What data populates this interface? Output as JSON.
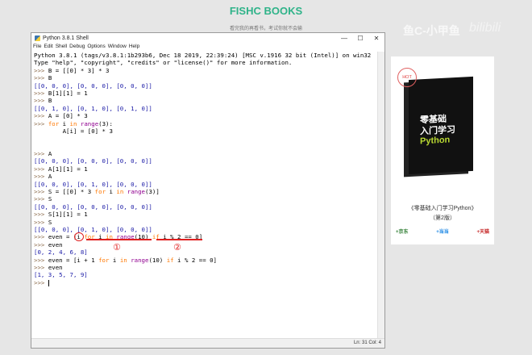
{
  "site": {
    "brand": "FISHC BOOKS",
    "slogan": "看完我的再看书，考试你就不会输",
    "watermark": "鱼C-小甲鱼",
    "watermark2": "bilibili"
  },
  "window": {
    "title": "Python 3.8.1 Shell",
    "controls": [
      "—",
      "☐",
      "✕"
    ],
    "menu": [
      "File",
      "Edit",
      "Shell",
      "Debug",
      "Options",
      "Window",
      "Help"
    ],
    "status": "Ln: 31  Col: 4"
  },
  "shell_lines": [
    [
      [
        "Python 3.8.1 (tags/v3.8.1:1b293b6, Dec 18 2019, 22:39:24) [MSC v.1916 32 bit (Intel)] on win32",
        "n"
      ]
    ],
    [
      [
        "Type \"help\", \"copyright\", \"credits\" or \"license()\" for more information.",
        "n"
      ]
    ],
    [
      [
        ">>> ",
        "p"
      ],
      [
        "B = [[0] * 3] * 3",
        "n"
      ]
    ],
    [
      [
        ">>> ",
        "p"
      ],
      [
        "B",
        "n"
      ]
    ],
    [
      [
        "[[0, 0, 0], [0, 0, 0], [0, 0, 0]]",
        "o"
      ]
    ],
    [
      [
        ">>> ",
        "p"
      ],
      [
        "B[1][1] = 1",
        "n"
      ]
    ],
    [
      [
        ">>> ",
        "p"
      ],
      [
        "B",
        "n"
      ]
    ],
    [
      [
        "[[0, 1, 0], [0, 1, 0], [0, 1, 0]]",
        "o"
      ]
    ],
    [
      [
        ">>> ",
        "p"
      ],
      [
        "A = [0] * 3",
        "n"
      ]
    ],
    [
      [
        ">>> ",
        "p"
      ],
      [
        "for",
        "k"
      ],
      [
        " i ",
        "n"
      ],
      [
        "in",
        "k"
      ],
      [
        " ",
        "n"
      ],
      [
        "range",
        "b"
      ],
      [
        "(3):",
        "n"
      ]
    ],
    [
      [
        "        A[i] = [0] * 3",
        "n"
      ]
    ],
    [],
    [],
    [
      [
        ">>> ",
        "p"
      ],
      [
        "A",
        "n"
      ]
    ],
    [
      [
        "[[0, 0, 0], [0, 0, 0], [0, 0, 0]]",
        "o"
      ]
    ],
    [
      [
        ">>> ",
        "p"
      ],
      [
        "A[1][1] = 1",
        "n"
      ]
    ],
    [
      [
        ">>> ",
        "p"
      ],
      [
        "A",
        "n"
      ]
    ],
    [
      [
        "[[0, 0, 0], [0, 1, 0], [0, 0, 0]]",
        "o"
      ]
    ],
    [
      [
        ">>> ",
        "p"
      ],
      [
        "S = [[0] * 3 ",
        "n"
      ],
      [
        "for",
        "k"
      ],
      [
        " i ",
        "n"
      ],
      [
        "in",
        "k"
      ],
      [
        " ",
        "n"
      ],
      [
        "range",
        "b"
      ],
      [
        "(3)]",
        "n"
      ]
    ],
    [
      [
        ">>> ",
        "p"
      ],
      [
        "S",
        "n"
      ]
    ],
    [
      [
        "[[0, 0, 0], [0, 0, 0], [0, 0, 0]]",
        "o"
      ]
    ],
    [
      [
        ">>> ",
        "p"
      ],
      [
        "S[1][1] = 1",
        "n"
      ]
    ],
    [
      [
        ">>> ",
        "p"
      ],
      [
        "S",
        "n"
      ]
    ],
    [
      [
        "[[0, 0, 0], [0, 1, 0], [0, 0, 0]]",
        "o"
      ]
    ],
    [
      [
        ">>> ",
        "p"
      ],
      [
        "even = [i ",
        "n"
      ],
      [
        "for",
        "k"
      ],
      [
        " i ",
        "n"
      ],
      [
        "in",
        "k"
      ],
      [
        " ",
        "n"
      ],
      [
        "range",
        "b"
      ],
      [
        "(10) ",
        "n"
      ],
      [
        "if",
        "k"
      ],
      [
        " i % 2 == 0]",
        "n"
      ]
    ],
    [
      [
        ">>> ",
        "p"
      ],
      [
        "even",
        "n"
      ]
    ],
    [
      [
        "[0, 2, 4, 6, 8]",
        "o"
      ]
    ],
    [
      [
        ">>> ",
        "p"
      ],
      [
        "even = [i + 1 ",
        "n"
      ],
      [
        "for",
        "k"
      ],
      [
        " i ",
        "n"
      ],
      [
        "in",
        "k"
      ],
      [
        " ",
        "n"
      ],
      [
        "range",
        "b"
      ],
      [
        "(10) ",
        "n"
      ],
      [
        "if",
        "k"
      ],
      [
        " i % 2 == 0]",
        "n"
      ]
    ],
    [
      [
        ">>> ",
        "p"
      ],
      [
        "even",
        "n"
      ]
    ],
    [
      [
        "[1, 3, 5, 7, 9]",
        "o"
      ]
    ],
    [
      [
        ">>> ",
        "p"
      ]
    ]
  ],
  "annotations": {
    "label1": "①",
    "label2": "②"
  },
  "book": {
    "badge": "HOT",
    "cover_line1": "零基础",
    "cover_line2": "入门学习",
    "cover_line3": "Python",
    "title": "《零基础入门学习Python》",
    "edition": "（第2版）",
    "stores": [
      {
        "label": "+京东",
        "color": "#2e7d32"
      },
      {
        "label": "+当当",
        "color": "#1e88e5"
      },
      {
        "label": "+天猫",
        "color": "#c62828"
      }
    ]
  }
}
